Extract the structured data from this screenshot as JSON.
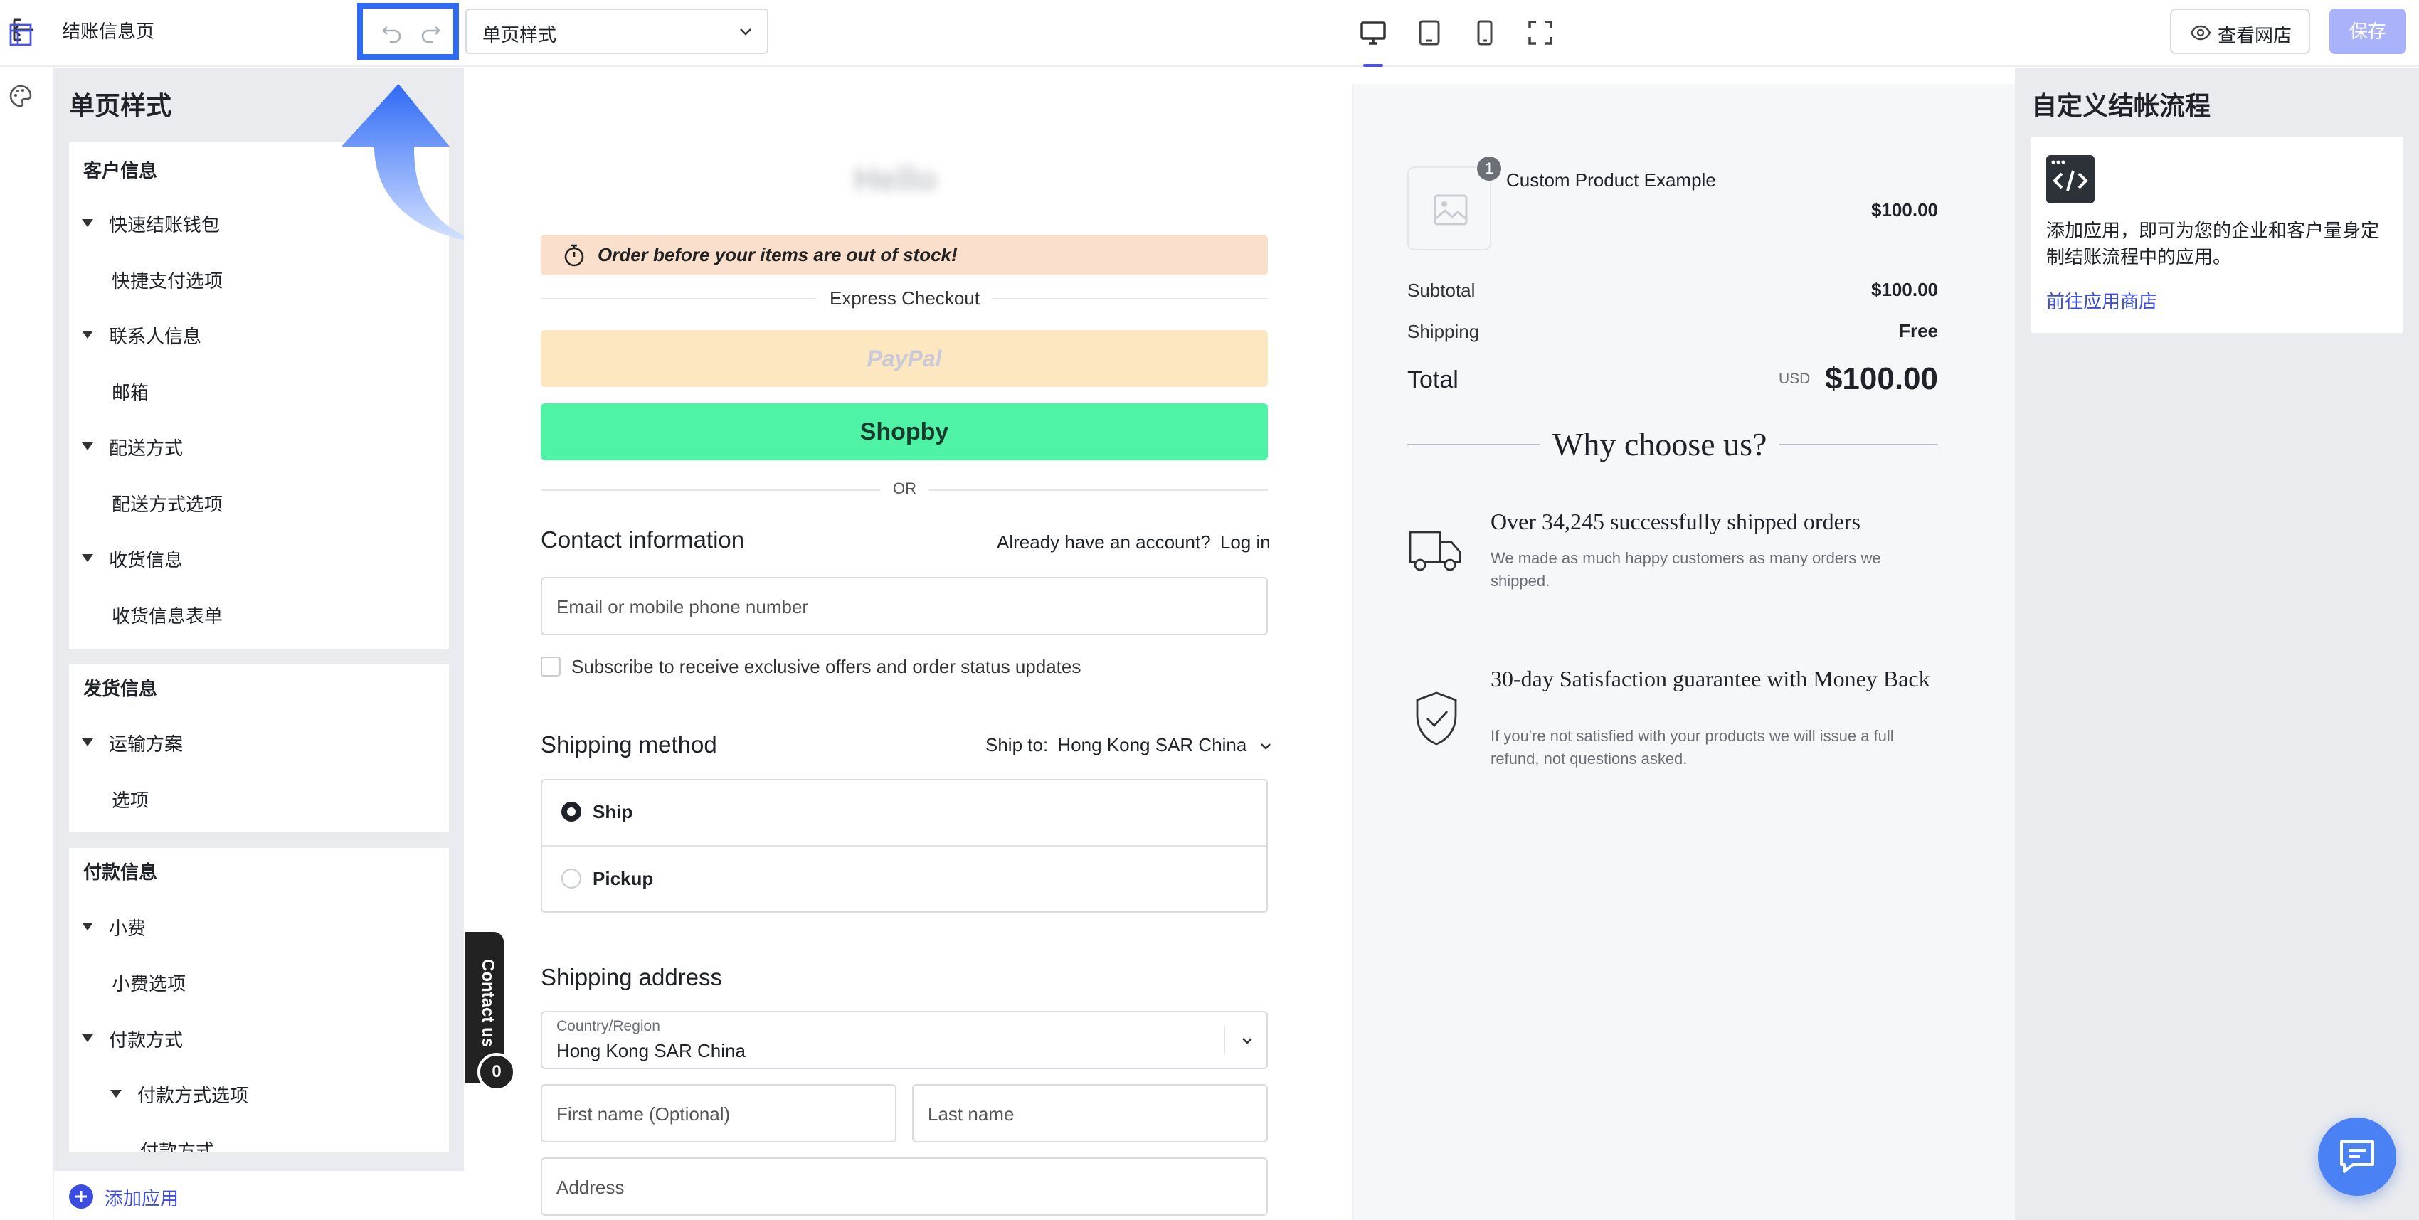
{
  "topbar": {
    "title": "结账信息页",
    "page_select": "单页样式",
    "view_shop": "查看网店",
    "save": "保存"
  },
  "left_panel": {
    "title": "单页样式",
    "sections": [
      {
        "title": "客户信息",
        "groups": [
          {
            "label": "快速结账钱包",
            "items": [
              "快捷支付选项"
            ]
          },
          {
            "label": "联系人信息",
            "items": [
              "邮箱"
            ]
          },
          {
            "label": "配送方式",
            "items": [
              "配送方式选项"
            ]
          },
          {
            "label": "收货信息",
            "items": [
              "收货信息表单"
            ]
          }
        ]
      },
      {
        "title": "发货信息",
        "groups": [
          {
            "label": "运输方案",
            "items": [
              "选项"
            ]
          }
        ]
      },
      {
        "title": "付款信息",
        "groups": [
          {
            "label": "小费",
            "items": [
              "小费选项"
            ]
          },
          {
            "label": "付款方式",
            "sub": {
              "label": "付款方式选项",
              "items": [
                "付款方式"
              ]
            }
          }
        ]
      }
    ],
    "add_app": "添加应用"
  },
  "checkout": {
    "logo": "Hello",
    "banner": "Order before your items are out of stock!",
    "express_checkout": "Express Checkout",
    "paypal": "PayPal",
    "shopby": "Shopby",
    "or": "OR",
    "contact_title": "Contact information",
    "already": "Already have an account?",
    "login": "Log in",
    "email_placeholder": "Email or mobile phone number",
    "subscribe": "Subscribe to receive exclusive offers and order status updates",
    "shipping_method_title": "Shipping method",
    "ship_to_label": "Ship to:",
    "ship_to_value": "Hong Kong SAR China",
    "option_ship": "Ship",
    "option_pickup": "Pickup",
    "shipping_address_title": "Shipping address",
    "country_label": "Country/Region",
    "country_value": "Hong Kong SAR China",
    "first_name_placeholder": "First name (Optional)",
    "last_name_placeholder": "Last name",
    "address_placeholder": "Address",
    "contact_us": "Contact us",
    "contact_badge": "0"
  },
  "summary": {
    "qty": "1",
    "product_name": "Custom Product Example",
    "product_price": "$100.00",
    "subtotal_label": "Subtotal",
    "subtotal_value": "$100.00",
    "shipping_label": "Shipping",
    "shipping_value": "Free",
    "total_label": "Total",
    "currency": "USD",
    "total_value": "$100.00",
    "why_title": "Why choose us?",
    "benefit1_title": "Over 34,245 successfully shipped orders",
    "benefit1_desc": "We made as much happy customers as many orders we shipped.",
    "benefit2_title": "30-day Satisfaction guarantee with Money Back",
    "benefit2_desc": "If you're not satisfied with your products we will issue a full refund, not questions asked."
  },
  "right_sidebar": {
    "title": "自定义结帐流程",
    "desc": "添加应用，即可为您的企业和客户量身定制结账流程中的应用。",
    "link": "前往应用商店"
  },
  "colors": {
    "accent": "#3b4ce0",
    "highlight": "#2f6af6",
    "banner": "#fbdfcd",
    "shopby": "#4ff3a6"
  }
}
